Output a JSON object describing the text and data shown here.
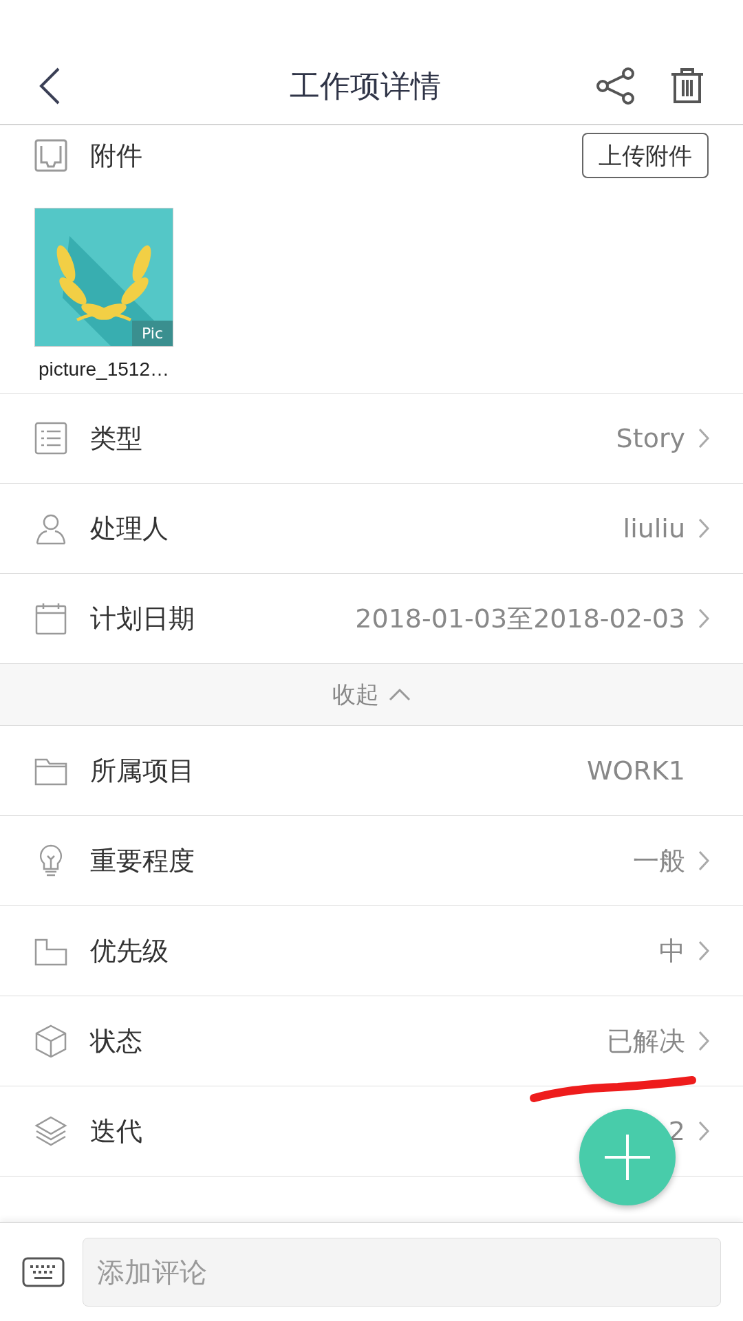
{
  "header": {
    "title": "工作项详情"
  },
  "attachments": {
    "label": "附件",
    "upload_button": "上传附件",
    "files": [
      {
        "kind": "picture",
        "badge": "Pic",
        "name": "picture_1512…"
      }
    ]
  },
  "fields": [
    {
      "label": "类型",
      "value": "Story",
      "chevron": true
    },
    {
      "label": "处理人",
      "value": "liuliu",
      "chevron": true
    },
    {
      "label": "计划日期",
      "value": "2018-01-03至2018-02-03",
      "chevron": true
    }
  ],
  "collapse_toggle": {
    "label": "收起",
    "expanded": true
  },
  "more_fields": [
    {
      "label": "所属项目",
      "value": "WORK1",
      "chevron": false
    },
    {
      "label": "重要程度",
      "value": "一般",
      "chevron": true
    },
    {
      "label": "优先级",
      "value": "中",
      "chevron": true
    },
    {
      "label": "状态",
      "value": "已解决",
      "chevron": true
    },
    {
      "label": "迭代",
      "value": "2",
      "chevron": true
    }
  ],
  "comment_bar": {
    "placeholder": "添加评论"
  }
}
